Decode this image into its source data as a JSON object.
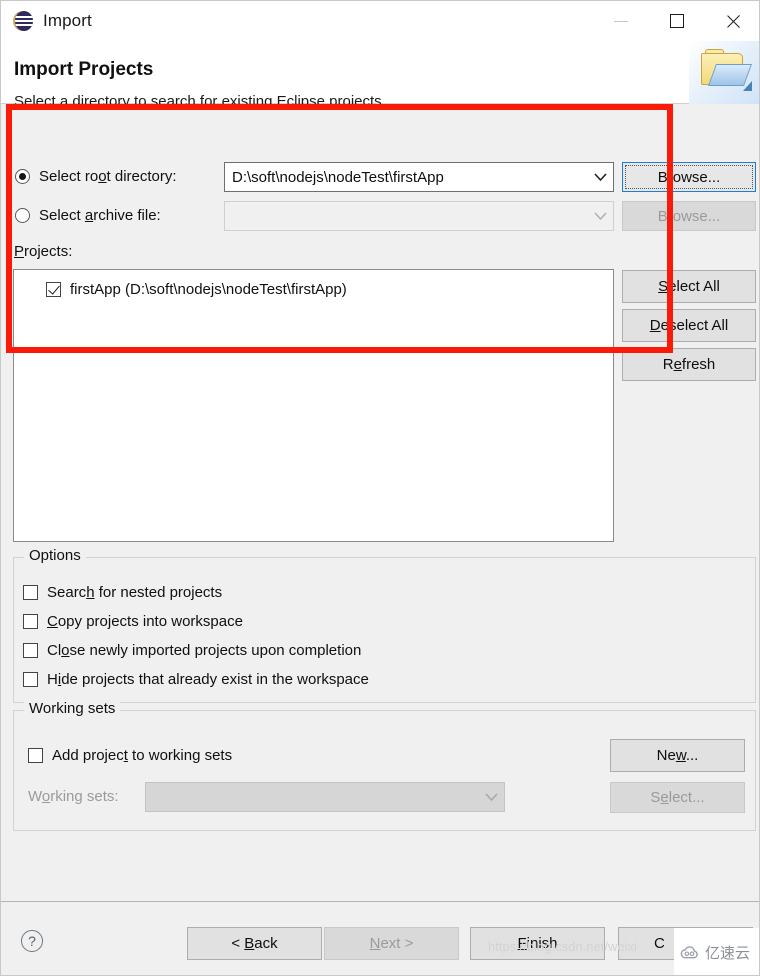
{
  "window": {
    "title": "Import",
    "icon": "eclipse-icon",
    "controls": {
      "minimize": "minimize-icon",
      "maximize": "maximize-icon",
      "close": "close-icon"
    }
  },
  "header": {
    "title": "Import Projects",
    "subtitle": "Select a directory to search for existing Eclipse projects.",
    "icon": "import-folder-icon"
  },
  "source": {
    "root_directory": {
      "label": "Select root directory:",
      "selected": true,
      "value": "D:\\soft\\nodejs\\nodeTest\\firstApp",
      "browse_label": "Browse..."
    },
    "archive_file": {
      "label": "Select archive file:",
      "selected": false,
      "value": "",
      "browse_label": "Browse..."
    }
  },
  "projects": {
    "label": "Projects:",
    "items": [
      {
        "label": "firstApp (D:\\soft\\nodejs\\nodeTest\\firstApp)",
        "checked": true
      }
    ],
    "buttons": {
      "select_all": "Select All",
      "deselect_all": "Deselect All",
      "refresh": "Refresh"
    }
  },
  "options": {
    "title": "Options",
    "items": [
      {
        "label": "Search for nested projects",
        "checked": false
      },
      {
        "label": "Copy projects into workspace",
        "checked": false
      },
      {
        "label": "Close newly imported projects upon completion",
        "checked": false
      },
      {
        "label": "Hide projects that already exist in the workspace",
        "checked": false
      }
    ]
  },
  "working_sets": {
    "title": "Working sets",
    "add_checkbox": {
      "label": "Add project to working sets",
      "checked": false
    },
    "new_button": "New...",
    "combo_label": "Working sets:",
    "combo_value": "",
    "select_button": "Select..."
  },
  "footer": {
    "help_icon": "help-icon",
    "back": "< Back",
    "next": "Next >",
    "finish": "Finish",
    "cancel": "C"
  },
  "watermark": {
    "url": "https://blog.csdn.net/weixi",
    "text": "亿速云"
  },
  "annotation": {
    "color": "#fb1a08"
  }
}
